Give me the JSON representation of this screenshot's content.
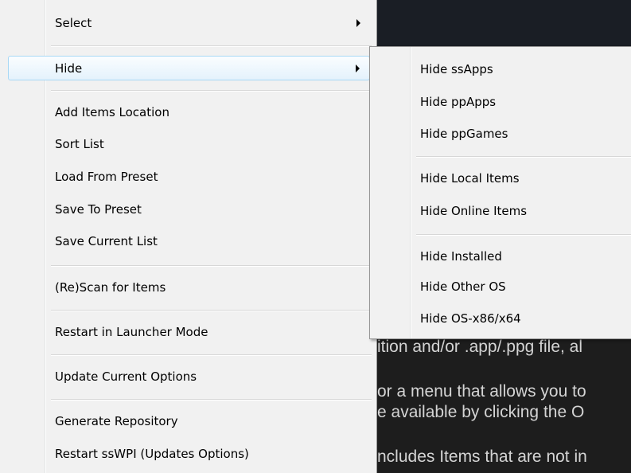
{
  "background_text": {
    "line1": "ition and/or .app/.ppg file, al",
    "line2": "or a menu that allows you to",
    "line3": "e available by clicking the O",
    "line4": "ncludes Items that are not in"
  },
  "context_menu": {
    "select": "Select",
    "hide": "Hide",
    "add_items_location": "Add Items Location",
    "sort_list": "Sort List",
    "load_from_preset": "Load From Preset",
    "save_to_preset": "Save To Preset",
    "save_current_list": "Save Current List",
    "rescan": "(Re)Scan for Items",
    "restart_launcher": "Restart in Launcher Mode",
    "update_options": "Update Current Options",
    "generate_repository": "Generate Repository",
    "restart_sswpi": "Restart ssWPI (Updates Options)"
  },
  "hide_submenu": {
    "ssapps": "Hide ssApps",
    "ppapps": "Hide ppApps",
    "ppgames": "Hide ppGames",
    "local_items": "Hide Local Items",
    "online_items": "Hide Online Items",
    "installed": "Hide Installed",
    "other_os": "Hide Other OS",
    "os_arch": "Hide OS-x86/x64"
  }
}
